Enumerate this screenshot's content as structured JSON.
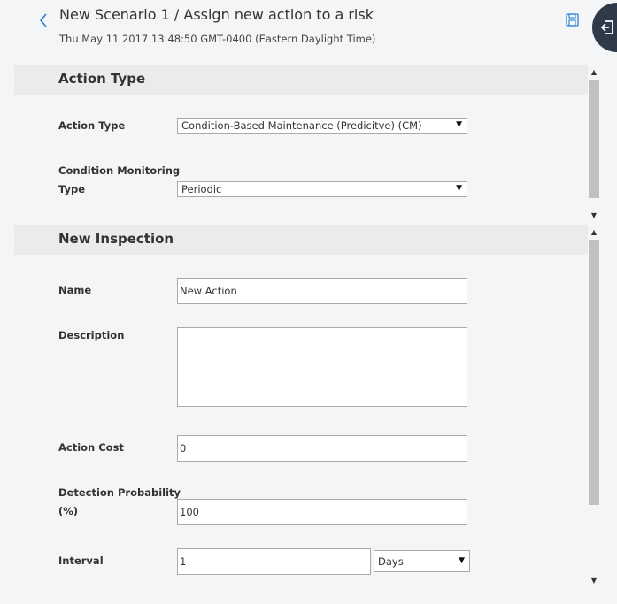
{
  "header": {
    "title": "New Scenario 1 / Assign new action to a risk",
    "subtitle": "Thu May 11 2017 13:48:50 GMT-0400 (Eastern Daylight Time)",
    "back_icon": "chevron-left-icon",
    "save_icon": "save-icon",
    "side_icon": "sign-in-icon"
  },
  "action_type_section": {
    "heading": "Action Type",
    "action_type_label": "Action Type",
    "action_type_value": "Condition-Based Maintenance (Predicitve) (CM)",
    "cm_type_label_line1": "Condition Monitoring",
    "cm_type_label_line2": "Type",
    "cm_type_value": "Periodic"
  },
  "inspection_section": {
    "heading": "New Inspection",
    "name_label": "Name",
    "name_value": "New Action",
    "description_label": "Description",
    "description_value": "",
    "action_cost_label": "Action Cost",
    "action_cost_value": "0",
    "detection_label_line1": "Detection Probability",
    "detection_label_line2": "(%)",
    "detection_value": "100",
    "interval_label": "Interval",
    "interval_value": "1",
    "interval_unit": "Days"
  },
  "colors": {
    "accent": "#2a7fd4",
    "section_header_bg": "#ebebeb",
    "page_bg": "#f4f5f6",
    "side_button_bg": "#2e3a48"
  }
}
